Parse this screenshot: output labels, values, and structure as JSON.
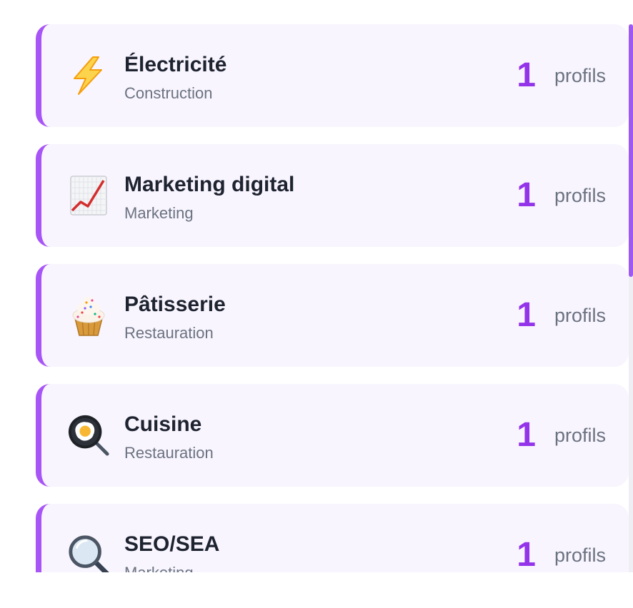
{
  "count_label": "profils",
  "accent_color": "#a855f7",
  "count_color": "#9333ea",
  "skills": [
    {
      "icon": "lightning-icon",
      "title": "Électricité",
      "category": "Construction",
      "count": "1"
    },
    {
      "icon": "chart-increasing-icon",
      "title": "Marketing digital",
      "category": "Marketing",
      "count": "1"
    },
    {
      "icon": "cupcake-icon",
      "title": "Pâtisserie",
      "category": "Restauration",
      "count": "1"
    },
    {
      "icon": "frying-pan-egg-icon",
      "title": "Cuisine",
      "category": "Restauration",
      "count": "1"
    },
    {
      "icon": "magnifying-glass-icon",
      "title": "SEO/SEA",
      "category": "Marketing",
      "count": "1"
    }
  ],
  "scrollbar": {
    "position": 0
  }
}
